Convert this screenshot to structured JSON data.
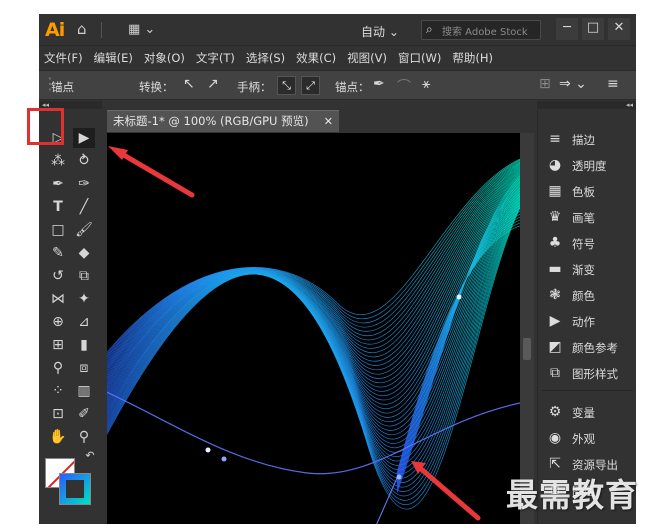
{
  "app": {
    "logo": "Ai",
    "home_icon": "home-icon",
    "workspace": "自动 ⌄",
    "stock_placeholder": "搜索 Adobe Stock"
  },
  "window_buttons": {
    "minimize": "─",
    "maximize": "□",
    "close": "✕"
  },
  "menu": [
    "文件(F)",
    "编辑(E)",
    "对象(O)",
    "文字(T)",
    "选择(S)",
    "效果(C)",
    "视图(V)",
    "窗口(W)",
    "帮助(H)"
  ],
  "control_bar": {
    "anchor_label": "锚点",
    "convert_label": "转换：",
    "handle_label": "手柄：",
    "anchor2_label": "锚点："
  },
  "document": {
    "tab_title": "未标题-1* @ 100% (RGB/GPU 预览)",
    "close": "✕"
  },
  "panels": [
    {
      "label": "描边",
      "icon": "stroke-lines-icon"
    },
    {
      "label": "透明度",
      "icon": "transparency-icon"
    },
    {
      "label": "色板",
      "icon": "swatches-icon"
    },
    {
      "label": "画笔",
      "icon": "brush-icon"
    },
    {
      "label": "符号",
      "icon": "club-symbol-icon"
    },
    {
      "label": "渐变",
      "icon": "gradient-icon"
    },
    {
      "label": "颜色",
      "icon": "color-palette-icon"
    },
    {
      "label": "动作",
      "icon": "play-icon"
    },
    {
      "label": "颜色参考",
      "icon": "color-guide-icon"
    },
    {
      "label": "图形样式",
      "icon": "graphic-styles-icon"
    },
    {
      "label": "变量",
      "icon": "gears-icon"
    },
    {
      "label": "外观",
      "icon": "appearance-icon"
    },
    {
      "label": "资源导出",
      "icon": "export-icon"
    },
    {
      "label": "图层",
      "icon": "layers-icon"
    }
  ],
  "watermark": "最需教育",
  "colors": {
    "accent_orange": "#ff9a00",
    "highlight_red": "#e03030",
    "wave_start": "#2a5cff",
    "wave_end": "#00f0c0"
  }
}
